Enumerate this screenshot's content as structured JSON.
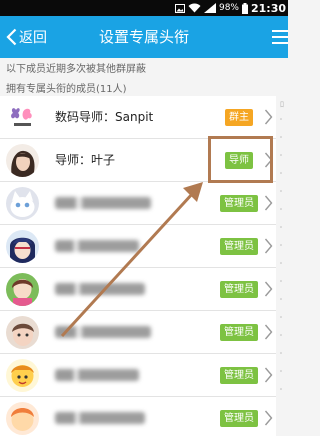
{
  "status_bar": {
    "battery_text": "98%",
    "time": "21:30",
    "icons": [
      "image-icon",
      "wifi-icon",
      "signal-icon",
      "battery-icon"
    ]
  },
  "nav": {
    "back_label": "返回",
    "title": "设置专属头衔"
  },
  "hint": "以下成员近期多次被其他群屏蔽",
  "section_title": "拥有专属头衔的成员(11人)",
  "rows": [
    {
      "name": "数码导师：Sanpit",
      "badge": "群主",
      "badge_color": "#f5a623",
      "blurred": false,
      "avatar": "logo-avatar"
    },
    {
      "name": "导师：叶子",
      "badge": "导师",
      "badge_color": "#7dc242",
      "blurred": false,
      "avatar": "girl-avatar"
    },
    {
      "name": "",
      "badge": "管理员",
      "badge_color": "#7dc242",
      "blurred": true,
      "avatar": "cat-avatar"
    },
    {
      "name": "",
      "badge": "管理员",
      "badge_color": "#7dc242",
      "blurred": true,
      "avatar": "anime-avatar"
    },
    {
      "name": "",
      "badge": "管理员",
      "badge_color": "#7dc242",
      "blurred": true,
      "avatar": "doll-avatar"
    },
    {
      "name": "",
      "badge": "管理员",
      "badge_color": "#7dc242",
      "blurred": true,
      "avatar": "child-avatar"
    },
    {
      "name": "",
      "badge": "管理员",
      "badge_color": "#7dc242",
      "blurred": true,
      "avatar": "cartoon-avatar"
    },
    {
      "name": "",
      "badge": "管理员",
      "badge_color": "#7dc242",
      "blurred": true,
      "avatar": "cartoon-avatar-2"
    }
  ],
  "accent_color": "#1aa3e4",
  "annotation_color": "#b17a51"
}
